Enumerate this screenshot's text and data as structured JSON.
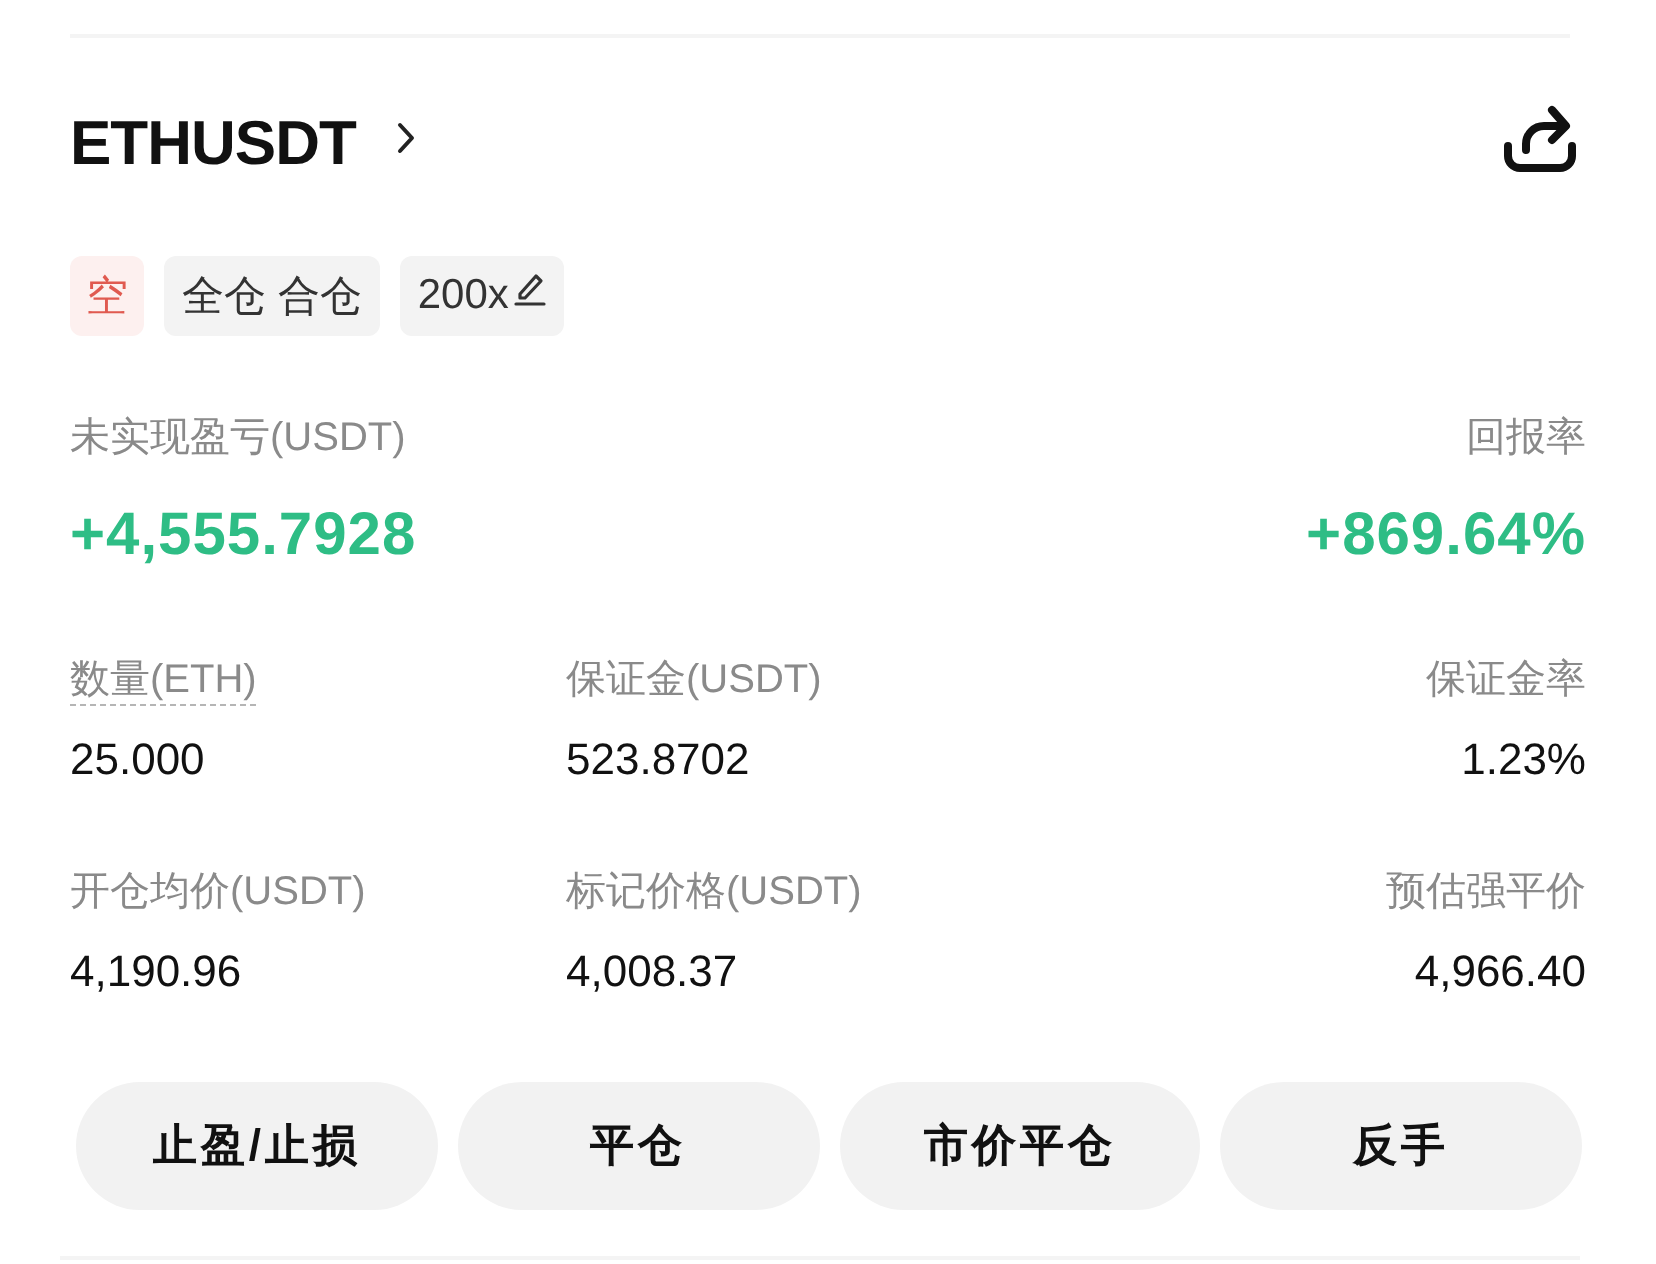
{
  "header": {
    "symbol": "ETHUSDT"
  },
  "tags": [
    {
      "kind": "side",
      "label": "空",
      "editable": false
    },
    {
      "kind": "mode",
      "label": "全仓 合仓",
      "editable": false
    },
    {
      "kind": "leverage",
      "label": "200x",
      "editable": true
    }
  ],
  "summary": [
    {
      "label": "未实现盈亏(USDT)",
      "value": "+4,555.7928"
    },
    {
      "label": "回报率",
      "value": "+869.64%"
    }
  ],
  "stats": [
    {
      "label": "数量(ETH)",
      "value": "25.000",
      "hint": true
    },
    {
      "label": "保证金(USDT)",
      "value": "523.8702",
      "hint": false
    },
    {
      "label": "保证金率",
      "value": "1.23%",
      "hint": false
    },
    {
      "label": "开仓均价(USDT)",
      "value": "4,190.96",
      "hint": false
    },
    {
      "label": "标记价格(USDT)",
      "value": "4,008.37",
      "hint": false
    },
    {
      "label": "预估强平价",
      "value": "4,966.40",
      "hint": false
    }
  ],
  "buttons": [
    "止盈/止损",
    "平仓",
    "市价平仓",
    "反手"
  ]
}
